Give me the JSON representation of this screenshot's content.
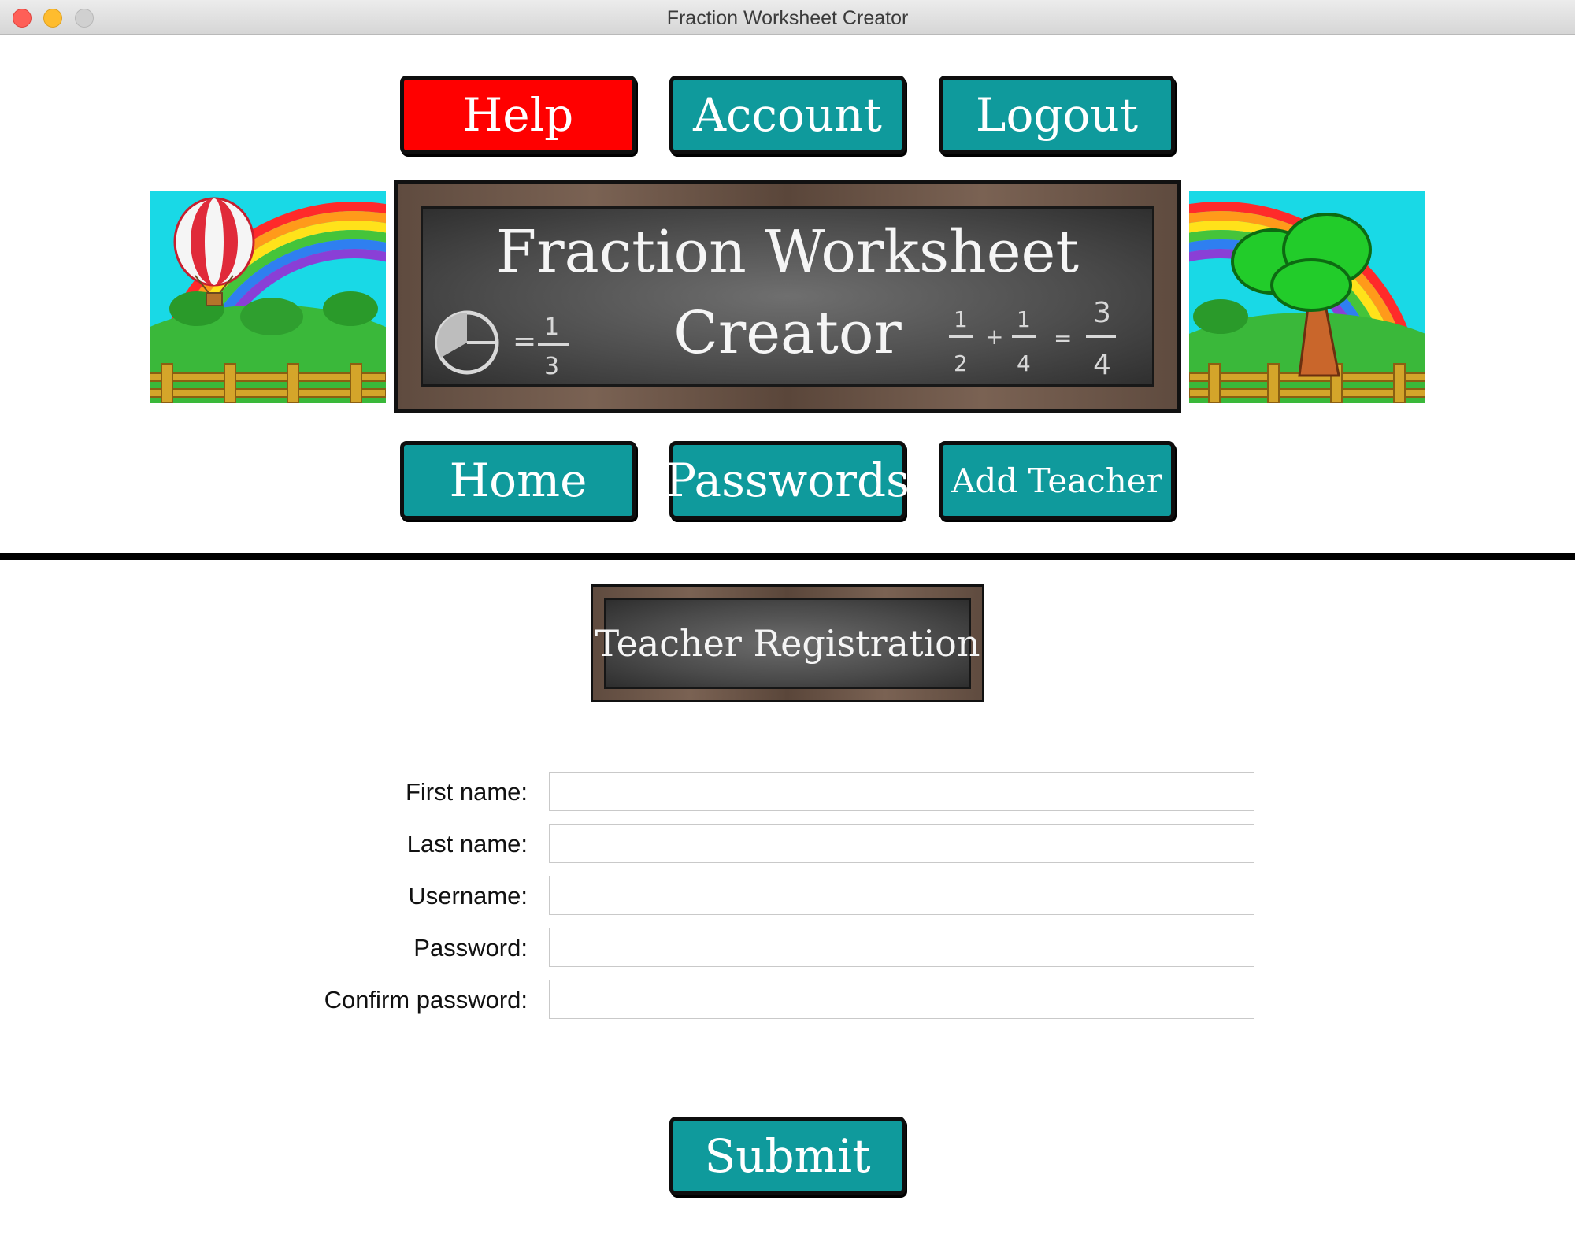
{
  "window": {
    "title": "Fraction Worksheet Creator"
  },
  "top_nav": {
    "help": "Help",
    "account": "Account",
    "logout": "Logout"
  },
  "banner": {
    "title_line1": "Fraction Worksheet",
    "title_line2": "Creator",
    "fraction_left": "= 1/3",
    "fraction_right": "1/2 + 1/4 = 3/4"
  },
  "sub_nav": {
    "home": "Home",
    "passwords": "Passwords",
    "add_teacher": "Add Teacher"
  },
  "section": {
    "title": "Teacher Registration"
  },
  "form": {
    "fields": [
      {
        "label": "First name:",
        "value": ""
      },
      {
        "label": "Last name:",
        "value": ""
      },
      {
        "label": "Username:",
        "value": ""
      },
      {
        "label": "Password:",
        "value": ""
      },
      {
        "label": "Confirm password:",
        "value": ""
      }
    ],
    "submit": "Submit"
  },
  "colors": {
    "teal_button": "#0f9a9c",
    "help_button": "#ff0000",
    "sky": "#19d9e6",
    "grass": "#39b53a"
  }
}
